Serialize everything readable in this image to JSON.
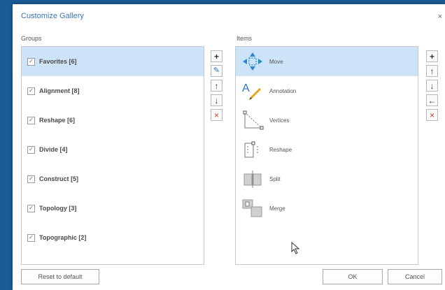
{
  "dialog": {
    "title": "Customize Gallery",
    "close": "×"
  },
  "groups": {
    "label": "Groups",
    "items": [
      {
        "label": "Favorites [6]",
        "checked": true,
        "selected": true
      },
      {
        "label": "Alignment [8]",
        "checked": true,
        "selected": false
      },
      {
        "label": "Reshape [6]",
        "checked": true,
        "selected": false
      },
      {
        "label": "Divide [4]",
        "checked": true,
        "selected": false
      },
      {
        "label": "Construct [5]",
        "checked": true,
        "selected": false
      },
      {
        "label": "Topology [3]",
        "checked": true,
        "selected": false
      },
      {
        "label": "Topographic [2]",
        "checked": true,
        "selected": false
      }
    ]
  },
  "groups_toolbar": {
    "add": "+",
    "edit": "✎",
    "up": "↑",
    "down": "↓",
    "remove": "×"
  },
  "items": {
    "label": "Items",
    "list": [
      {
        "label": "Move",
        "icon": "move-icon",
        "selected": true
      },
      {
        "label": "Annotation",
        "icon": "annotation-icon",
        "selected": false
      },
      {
        "label": "Vertices",
        "icon": "vertices-icon",
        "selected": false
      },
      {
        "label": "Reshape",
        "icon": "reshape-icon",
        "selected": false
      },
      {
        "label": "Split",
        "icon": "split-icon",
        "selected": false
      },
      {
        "label": "Merge",
        "icon": "merge-icon",
        "selected": false
      }
    ]
  },
  "items_toolbar": {
    "add": "+",
    "up": "↑",
    "down": "↓",
    "move_left": "←",
    "remove": "×"
  },
  "footer": {
    "reset": "Reset to default",
    "ok": "OK",
    "cancel": "Cancel"
  },
  "colors": {
    "accent": "#3a75b8",
    "selection": "#cde3f7",
    "remove": "#d23a2a",
    "background": "#1b5c97"
  }
}
